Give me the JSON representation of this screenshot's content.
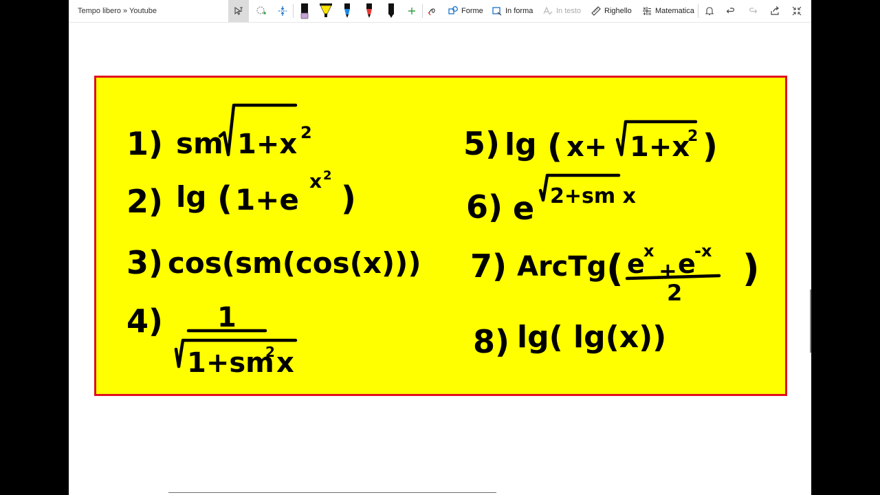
{
  "toolbar": {
    "breadcrumb": "Tempo libero » Youtube",
    "shapes_label": "Forme",
    "ink_to_shape_label": "In forma",
    "ink_to_text_label": "In testo",
    "ruler_label": "Righello",
    "math_label": "Matematica",
    "pens": [
      {
        "icon": "pen-black-icon",
        "color": "#111111"
      },
      {
        "icon": "highlighter-yellow-icon",
        "color": "#ffe600"
      },
      {
        "icon": "pen-blue-icon",
        "color": "#1e88e5"
      },
      {
        "icon": "pen-red-icon",
        "color": "#e53935"
      },
      {
        "icon": "pen-black-icon",
        "color": "#111111"
      }
    ],
    "colors": {
      "accent": "#1a73c8",
      "add": "#2e9e3f",
      "eraser": "#c8a0d8"
    }
  },
  "note": {
    "background": "#ffff00",
    "border": "#e0101e",
    "exercises": [
      {
        "number": "1)",
        "expression": "sin √(1+x²)"
      },
      {
        "number": "2)",
        "expression": "lg(1+e^(x²))"
      },
      {
        "number": "3)",
        "expression": "cos(sin(cos(x)))"
      },
      {
        "number": "4)",
        "expression": "1 / √(1+sin²x)"
      },
      {
        "number": "5)",
        "expression": "lg(x+√(1+x²))"
      },
      {
        "number": "6)",
        "expression": "e^(√(2+sin x))"
      },
      {
        "number": "7)",
        "expression": "ArcTg((e^x+e^-x)/2)"
      },
      {
        "number": "8)",
        "expression": "lg(lg(x))"
      }
    ]
  }
}
